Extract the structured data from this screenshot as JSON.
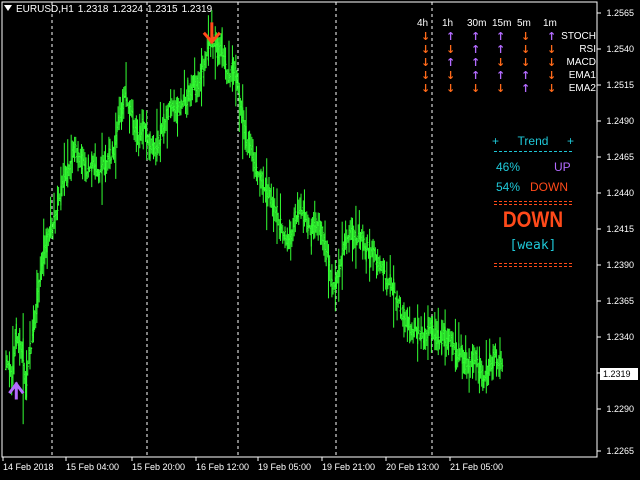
{
  "window": {
    "symbol": "EURUSD,H1",
    "ohlc": [
      "1.2318",
      "1.2324",
      "1.2315",
      "1.2319"
    ]
  },
  "price_axis": {
    "labels": [
      "1.2565",
      "1.2540",
      "1.2515",
      "1.2490",
      "1.2465",
      "1.2440",
      "1.2415",
      "1.2390",
      "1.2365",
      "1.2340",
      "1.2315",
      "1.2290",
      "1.2265"
    ],
    "current_price": "1.2319"
  },
  "time_axis": {
    "labels": [
      "14 Feb 2018",
      "15 Feb 04:00",
      "15 Feb 20:00",
      "16 Feb 12:00",
      "19 Feb 05:00",
      "19 Feb 21:00",
      "20 Feb 13:00",
      "21 Feb 05:00"
    ]
  },
  "signal_panel": {
    "timeframes": [
      "4h",
      "1h",
      "30m",
      "15m",
      "5m",
      "1m"
    ],
    "indicators": [
      {
        "name": "STOCH",
        "signals": [
          "down",
          "up",
          "up",
          "up",
          "down",
          "up"
        ]
      },
      {
        "name": "RSI",
        "signals": [
          "down",
          "down",
          "up",
          "up",
          "down",
          "down"
        ]
      },
      {
        "name": "MACD",
        "signals": [
          "down",
          "up",
          "up",
          "down",
          "down",
          "down"
        ]
      },
      {
        "name": "EMA1",
        "signals": [
          "down",
          "down",
          "up",
          "up",
          "up",
          "down"
        ]
      },
      {
        "name": "EMA2",
        "signals": [
          "down",
          "down",
          "down",
          "down",
          "up",
          "down"
        ]
      }
    ],
    "colors": {
      "up": "#b36bff",
      "down": "#ff6a1a"
    }
  },
  "trend_panel": {
    "plus_left": "+",
    "title": "Trend",
    "plus_right": "+",
    "up_pct": "46%",
    "up_label": "UP",
    "down_pct": "54%",
    "down_label": "DOWN",
    "verdict": "DOWN",
    "strength": "[weak]",
    "colors": {
      "accent": "#1fc8d8",
      "up": "#b36bff",
      "down": "#ff4a1a"
    }
  },
  "chart_data": {
    "type": "candlestick",
    "bar_color": "#33ff33",
    "background": "#000000",
    "ylim": [
      1.2253,
      1.2577
    ],
    "ohlc_series": [
      1.2318,
      1.2305,
      1.234,
      1.2336,
      1.233,
      1.23,
      1.2325,
      1.234,
      1.236,
      1.238,
      1.2395,
      1.2405,
      1.2415,
      1.242,
      1.243,
      1.244,
      1.245,
      1.2455,
      1.2462,
      1.247,
      1.2472,
      1.2465,
      1.246,
      1.2458,
      1.2463,
      1.246,
      1.2455,
      1.2458,
      1.2462,
      1.2468,
      1.247,
      1.2475,
      1.249,
      1.25,
      1.251,
      1.2505,
      1.2495,
      1.2485,
      1.248,
      1.249,
      1.2485,
      1.2478,
      1.2475,
      1.247,
      1.248,
      1.2488,
      1.2495,
      1.2503,
      1.2505,
      1.25,
      1.2502,
      1.2505,
      1.2508,
      1.2512,
      1.2515,
      1.2518,
      1.2525,
      1.253,
      1.254,
      1.255,
      1.2548,
      1.254,
      1.2545,
      1.2535,
      1.2525,
      1.253,
      1.2528,
      1.2515,
      1.2495,
      1.248,
      1.2475,
      1.247,
      1.246,
      1.2455,
      1.245,
      1.2445,
      1.244,
      1.2435,
      1.243,
      1.242,
      1.2412,
      1.2408,
      1.241,
      1.2418,
      1.2425,
      1.243,
      1.2425,
      1.242,
      1.2415,
      1.2418,
      1.242,
      1.2415,
      1.2405,
      1.2395,
      1.2378,
      1.2372,
      1.2385,
      1.2395,
      1.2405,
      1.241,
      1.2412,
      1.241,
      1.2408,
      1.241,
      1.2405,
      1.24,
      1.2398,
      1.2395,
      1.239,
      1.2385,
      1.238,
      1.2378,
      1.237,
      1.2365,
      1.236,
      1.2355,
      1.235,
      1.2345,
      1.2345,
      1.2342,
      1.234,
      1.2338,
      1.2342,
      1.2345,
      1.234,
      1.2338,
      1.2338,
      1.234,
      1.2336,
      1.2335,
      1.233,
      1.2325,
      1.233,
      1.232,
      1.2318,
      1.2322,
      1.2325,
      1.2318,
      1.2312,
      1.231,
      1.2318,
      1.2322,
      1.2325,
      1.2319,
      1.2319
    ],
    "markers": [
      {
        "type": "up-arrow",
        "color": "#b36bff",
        "at_price": 1.2305,
        "at_bar": 3
      },
      {
        "type": "down-arrow",
        "color": "#ff4a1a",
        "at_price": 1.255,
        "at_bar": 60
      }
    ]
  }
}
